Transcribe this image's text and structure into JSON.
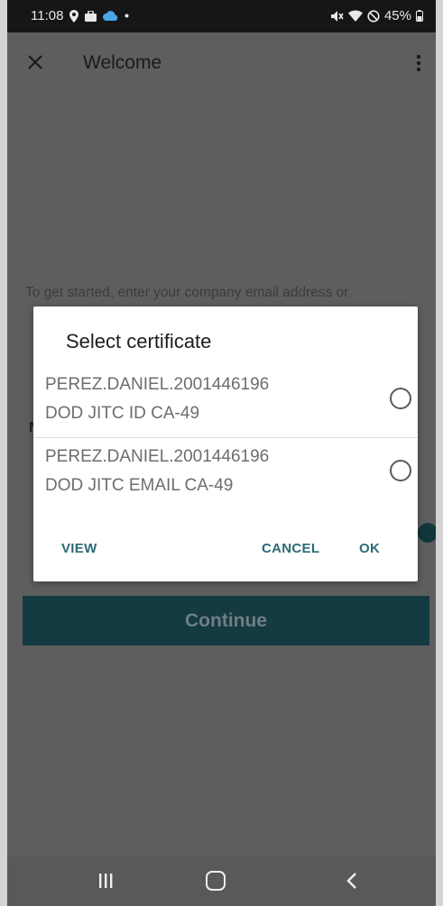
{
  "status_bar": {
    "time": "11:08",
    "battery": "45%"
  },
  "app_bar": {
    "title": "Welcome"
  },
  "background": {
    "intro_text": "To get started, enter your company email address or",
    "peek_char": "N",
    "continue_label": "Continue"
  },
  "dialog": {
    "title": "Select certificate",
    "certificates": [
      {
        "name": "PEREZ.DANIEL.2001446196",
        "issuer": "DOD JITC ID CA-49",
        "selected": false
      },
      {
        "name": "PEREZ.DANIEL.2001446196",
        "issuer": "DOD JITC EMAIL CA-49",
        "selected": false
      }
    ],
    "buttons": {
      "view": "VIEW",
      "cancel": "CANCEL",
      "ok": "OK"
    }
  },
  "colors": {
    "accent": "#2b6b75",
    "continue_bg": "#143a42",
    "scrim": "#5e5e5e"
  }
}
